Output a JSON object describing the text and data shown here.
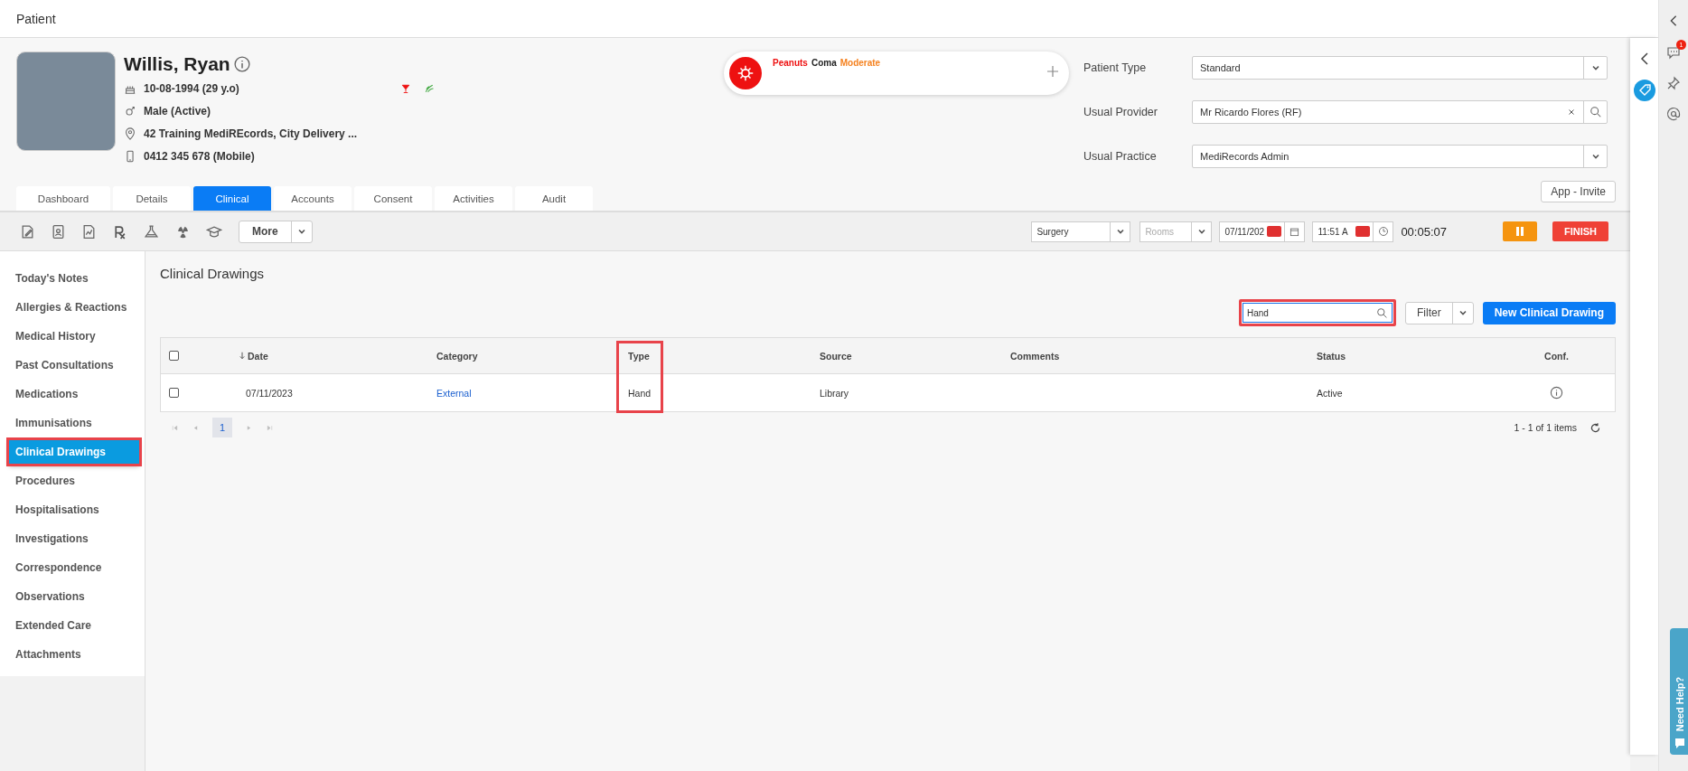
{
  "window": {
    "title": "Patient"
  },
  "patient": {
    "name": "Willis, Ryan",
    "dob": "10-08-1994 (29 y.o)",
    "gender": "Male (Active)",
    "address": "42 Training MediREcords, City Delivery ...",
    "phone": "0412 345 678 (Mobile)"
  },
  "alerts": [
    {
      "text": "Peanuts",
      "color": "#ee1111"
    },
    {
      "text": "Coma",
      "color": "#222222"
    },
    {
      "text": "Moderate",
      "color": "#f58220"
    }
  ],
  "fields": [
    {
      "label": "Patient Type",
      "value": "Standard",
      "kind": "select"
    },
    {
      "label": "Usual Provider",
      "value": "Mr Ricardo Flores (RF)",
      "kind": "search"
    },
    {
      "label": "Usual Practice",
      "value": "MediRecords Admin",
      "kind": "select"
    }
  ],
  "app_invite": "App - Invite",
  "tabs": [
    {
      "label": "Dashboard",
      "selected": false
    },
    {
      "label": "Details",
      "selected": false
    },
    {
      "label": "Clinical",
      "selected": true
    },
    {
      "label": "Accounts",
      "selected": false
    },
    {
      "label": "Consent",
      "selected": false
    },
    {
      "label": "Activities",
      "selected": false
    },
    {
      "label": "Audit",
      "selected": false
    }
  ],
  "toolbar": {
    "more": "More",
    "location": "Surgery",
    "rooms_placeholder": "Rooms",
    "date": "07/11/202",
    "time": "11:51 A",
    "timer": "00:05:07",
    "finish": "FINISH"
  },
  "sidebar": {
    "items": [
      {
        "label": "Today's Notes",
        "selected": false
      },
      {
        "label": "Allergies & Reactions",
        "selected": false
      },
      {
        "label": "Medical History",
        "selected": false
      },
      {
        "label": "Past Consultations",
        "selected": false
      },
      {
        "label": "Medications",
        "selected": false
      },
      {
        "label": "Immunisations",
        "selected": false
      },
      {
        "label": "Clinical Drawings",
        "selected": true
      },
      {
        "label": "Procedures",
        "selected": false
      },
      {
        "label": "Hospitalisations",
        "selected": false
      },
      {
        "label": "Investigations",
        "selected": false
      },
      {
        "label": "Correspondence",
        "selected": false
      },
      {
        "label": "Observations",
        "selected": false
      },
      {
        "label": "Extended Care",
        "selected": false
      },
      {
        "label": "Attachments",
        "selected": false
      }
    ]
  },
  "content": {
    "title": "Clinical Drawings",
    "search": {
      "value": "Hand"
    },
    "filter": "Filter",
    "new_button": "New Clinical Drawing",
    "table": {
      "all_checked": false,
      "columns": [
        {
          "label": "Date",
          "sorted": true
        },
        {
          "label": "Category",
          "sorted": false
        },
        {
          "label": "Type",
          "sorted": false
        },
        {
          "label": "Source",
          "sorted": false
        },
        {
          "label": "Comments",
          "sorted": false
        },
        {
          "label": "Status",
          "sorted": false
        },
        {
          "label": "Conf.",
          "sorted": false
        }
      ],
      "rows": [
        {
          "checked": false,
          "date": "07/11/2023",
          "category": "External",
          "type": "Hand",
          "source": "Library",
          "status": "Active"
        }
      ]
    },
    "pager": {
      "pages": [
        {
          "label": "1",
          "selected": true
        }
      ],
      "info": "1 - 1 of 1 items"
    }
  },
  "rail": {
    "chat_badge": "1",
    "help": "Need Help?"
  }
}
